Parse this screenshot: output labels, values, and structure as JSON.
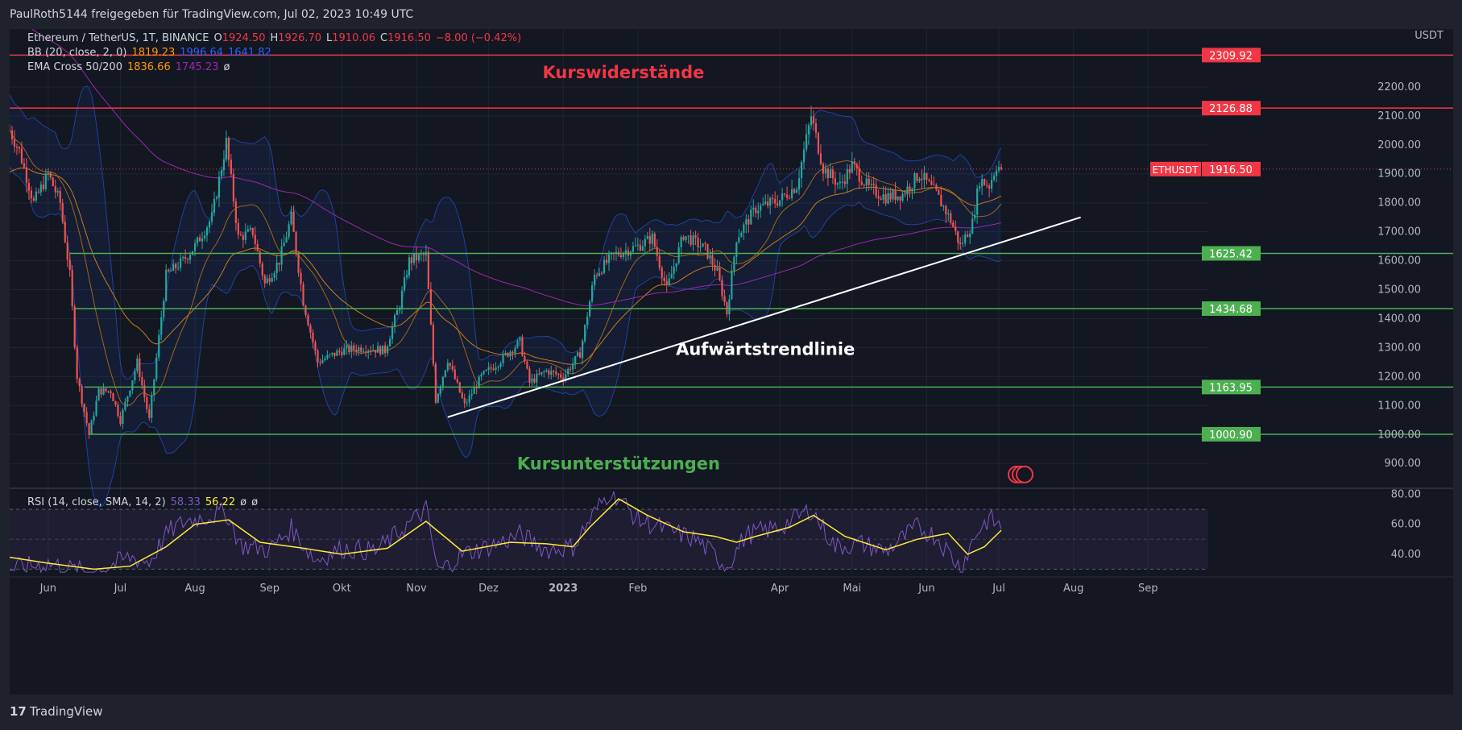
{
  "header": {
    "shared_by": "PaulRoth5144 freigegeben für TradingView.com, Jul 02, 2023 10:49 UTC"
  },
  "legend": {
    "symbol": "Ethereum / TetherUS, 1T, BINANCE",
    "o_label": "O",
    "o": "1924.50",
    "h_label": "H",
    "h": "1926.70",
    "l_label": "L",
    "l": "1910.06",
    "c_label": "C",
    "c": "1916.50",
    "change": "−8.00 (−0.42%)",
    "bb_label": "BB (20, close, 2, 0)",
    "bb_basis": "1819.23",
    "bb_upper": "1996.64",
    "bb_lower": "1641.82",
    "ema_label": "EMA Cross 50/200",
    "ema50": "1836.66",
    "ema200": "1745.23",
    "ema_extra": "ø",
    "rsi_label": "RSI (14, close, SMA, 14, 2)",
    "rsi": "58.33",
    "rsi_sma": "56.22",
    "rsi_extra1": "ø",
    "rsi_extra2": "ø"
  },
  "colors": {
    "up": "#26a69a",
    "down": "#ef5350",
    "resistance": "#f23645",
    "support": "#4caf50",
    "bb": "#2962ff",
    "ema50": "#ff9800",
    "ema200": "#9c27b0",
    "rsi": "#7e57c2",
    "rsi_sma": "#ffeb3b"
  },
  "chart_data": {
    "type": "candlestick",
    "symbol": "ETHUSDT",
    "currency": "USDT",
    "price_axis": {
      "range": [
        820,
        2400
      ],
      "ticks": [
        "900.00",
        "1000.00",
        "1100.00",
        "1200.00",
        "1300.00",
        "1400.00",
        "1500.00",
        "1600.00",
        "1700.00",
        "1800.00",
        "1900.00",
        "2000.00",
        "2100.00",
        "2200.00"
      ]
    },
    "x_axis": {
      "start": "2022-05-16",
      "end": "2023-09-26",
      "ticks": [
        {
          "date": "2022-06-01",
          "label": "Jun"
        },
        {
          "date": "2022-07-01",
          "label": "Jul"
        },
        {
          "date": "2022-08-01",
          "label": "Aug"
        },
        {
          "date": "2022-09-01",
          "label": "Sep"
        },
        {
          "date": "2022-10-01",
          "label": "Okt"
        },
        {
          "date": "2022-11-01",
          "label": "Nov"
        },
        {
          "date": "2022-12-01",
          "label": "Dez"
        },
        {
          "date": "2023-01-01",
          "label": "2023"
        },
        {
          "date": "2023-02-01",
          "label": "Feb"
        },
        {
          "date": "2023-04-01",
          "label": "Apr"
        },
        {
          "date": "2023-05-01",
          "label": "Mai"
        },
        {
          "date": "2023-06-01",
          "label": "Jun"
        },
        {
          "date": "2023-07-01",
          "label": "Jul"
        },
        {
          "date": "2023-08-01",
          "label": "Aug"
        },
        {
          "date": "2023-09-01",
          "label": "Sep"
        }
      ]
    },
    "resistances": [
      {
        "value": 2309.92,
        "label": "2309.92"
      },
      {
        "value": 2126.88,
        "label": "2126.88"
      }
    ],
    "supports": [
      {
        "value": 1625.42,
        "label": "1625.42",
        "from": "2022-06-10"
      },
      {
        "value": 1434.68,
        "label": "1434.68",
        "from": "2022-06-12"
      },
      {
        "value": 1163.95,
        "label": "1163.95",
        "from": "2022-06-16"
      },
      {
        "value": 1000.9,
        "label": "1000.90",
        "from": "2022-06-18"
      }
    ],
    "current_price": {
      "value": 1916.5,
      "label": "1916.50",
      "symbol_label": "ETHUSDT"
    },
    "trendline": {
      "from": {
        "date": "2022-11-14",
        "value": 1060
      },
      "to": {
        "date": "2023-08-04",
        "value": 1750
      }
    },
    "annotations": {
      "resistance": "Kurswiderstände",
      "support": "Kursunterstützungen",
      "trendline": "Aufwärtstrendlinie"
    },
    "price_path": [
      [
        "2022-05-16",
        2050
      ],
      [
        "2022-05-20",
        1980
      ],
      [
        "2022-05-26",
        1800
      ],
      [
        "2022-06-01",
        1900
      ],
      [
        "2022-06-06",
        1800
      ],
      [
        "2022-06-10",
        1550
      ],
      [
        "2022-06-13",
        1200
      ],
      [
        "2022-06-18",
        1000
      ],
      [
        "2022-06-22",
        1150
      ],
      [
        "2022-06-27",
        1150
      ],
      [
        "2022-07-01",
        1050
      ],
      [
        "2022-07-08",
        1250
      ],
      [
        "2022-07-13",
        1050
      ],
      [
        "2022-07-20",
        1550
      ],
      [
        "2022-07-27",
        1600
      ],
      [
        "2022-08-01",
        1650
      ],
      [
        "2022-08-08",
        1750
      ],
      [
        "2022-08-14",
        2010
      ],
      [
        "2022-08-19",
        1680
      ],
      [
        "2022-08-25",
        1700
      ],
      [
        "2022-08-30",
        1520
      ],
      [
        "2022-09-05",
        1600
      ],
      [
        "2022-09-10",
        1750
      ],
      [
        "2022-09-15",
        1460
      ],
      [
        "2022-09-21",
        1250
      ],
      [
        "2022-10-01",
        1290
      ],
      [
        "2022-10-10",
        1300
      ],
      [
        "2022-10-19",
        1290
      ],
      [
        "2022-10-25",
        1450
      ],
      [
        "2022-10-29",
        1600
      ],
      [
        "2022-11-05",
        1620
      ],
      [
        "2022-11-09",
        1120
      ],
      [
        "2022-11-14",
        1260
      ],
      [
        "2022-11-21",
        1100
      ],
      [
        "2022-11-28",
        1200
      ],
      [
        "2022-12-05",
        1250
      ],
      [
        "2022-12-14",
        1320
      ],
      [
        "2022-12-18",
        1180
      ],
      [
        "2022-12-25",
        1220
      ],
      [
        "2023-01-01",
        1200
      ],
      [
        "2023-01-08",
        1280
      ],
      [
        "2023-01-14",
        1550
      ],
      [
        "2023-01-22",
        1620
      ],
      [
        "2023-02-01",
        1650
      ],
      [
        "2023-02-07",
        1680
      ],
      [
        "2023-02-13",
        1500
      ],
      [
        "2023-02-20",
        1690
      ],
      [
        "2023-03-01",
        1640
      ],
      [
        "2023-03-06",
        1560
      ],
      [
        "2023-03-10",
        1420
      ],
      [
        "2023-03-14",
        1680
      ],
      [
        "2023-03-22",
        1780
      ],
      [
        "2023-04-01",
        1810
      ],
      [
        "2023-04-08",
        1860
      ],
      [
        "2023-04-14",
        2100
      ],
      [
        "2023-04-19",
        1920
      ],
      [
        "2023-04-26",
        1860
      ],
      [
        "2023-05-01",
        1930
      ],
      [
        "2023-05-08",
        1850
      ],
      [
        "2023-05-15",
        1820
      ],
      [
        "2023-05-22",
        1830
      ],
      [
        "2023-05-29",
        1900
      ],
      [
        "2023-06-05",
        1830
      ],
      [
        "2023-06-11",
        1740
      ],
      [
        "2023-06-15",
        1650
      ],
      [
        "2023-06-20",
        1730
      ],
      [
        "2023-06-23",
        1880
      ],
      [
        "2023-06-27",
        1860
      ],
      [
        "2023-06-30",
        1930
      ],
      [
        "2023-07-02",
        1916.5
      ]
    ],
    "rsi_axis": {
      "range": [
        27,
        83
      ],
      "ticks": [
        "40.00",
        "60.00",
        "80.00"
      ],
      "upper_band": 70,
      "lower_band": 30,
      "mid": 50
    },
    "rsi_path": [
      [
        "2022-05-16",
        30
      ],
      [
        "2022-06-01",
        34
      ],
      [
        "2022-06-13",
        29
      ],
      [
        "2022-06-20",
        28
      ],
      [
        "2022-07-05",
        38
      ],
      [
        "2022-07-13",
        35
      ],
      [
        "2022-07-21",
        55
      ],
      [
        "2022-07-28",
        62
      ],
      [
        "2022-08-14",
        68
      ],
      [
        "2022-08-20",
        46
      ],
      [
        "2022-09-01",
        43
      ],
      [
        "2022-09-10",
        57
      ],
      [
        "2022-09-20",
        36
      ],
      [
        "2022-10-01",
        44
      ],
      [
        "2022-10-15",
        42
      ],
      [
        "2022-10-25",
        55
      ],
      [
        "2022-11-05",
        70
      ],
      [
        "2022-11-10",
        28
      ],
      [
        "2022-11-20",
        40
      ],
      [
        "2022-12-05",
        47
      ],
      [
        "2022-12-14",
        53
      ],
      [
        "2022-12-25",
        43
      ],
      [
        "2023-01-05",
        45
      ],
      [
        "2023-01-15",
        70
      ],
      [
        "2023-01-21",
        83
      ],
      [
        "2023-02-01",
        63
      ],
      [
        "2023-02-10",
        58
      ],
      [
        "2023-02-25",
        50
      ],
      [
        "2023-03-10",
        32
      ],
      [
        "2023-03-18",
        53
      ],
      [
        "2023-04-01",
        58
      ],
      [
        "2023-04-14",
        70
      ],
      [
        "2023-04-24",
        45
      ],
      [
        "2023-05-05",
        47
      ],
      [
        "2023-05-15",
        42
      ],
      [
        "2023-05-28",
        58
      ],
      [
        "2023-06-05",
        52
      ],
      [
        "2023-06-15",
        31
      ],
      [
        "2023-06-22",
        55
      ],
      [
        "2023-06-27",
        64
      ],
      [
        "2023-07-02",
        58
      ]
    ],
    "rsi_sma_path": [
      [
        "2022-05-16",
        38
      ],
      [
        "2022-06-01",
        34
      ],
      [
        "2022-06-20",
        30
      ],
      [
        "2022-07-05",
        32
      ],
      [
        "2022-07-20",
        45
      ],
      [
        "2022-08-01",
        60
      ],
      [
        "2022-08-15",
        63
      ],
      [
        "2022-08-28",
        48
      ],
      [
        "2022-09-15",
        44
      ],
      [
        "2022-10-01",
        40
      ],
      [
        "2022-10-20",
        44
      ],
      [
        "2022-11-05",
        62
      ],
      [
        "2022-11-20",
        42
      ],
      [
        "2022-12-10",
        48
      ],
      [
        "2022-12-25",
        47
      ],
      [
        "2023-01-05",
        45
      ],
      [
        "2023-01-12",
        58
      ],
      [
        "2023-01-24",
        77
      ],
      [
        "2023-02-05",
        66
      ],
      [
        "2023-02-20",
        55
      ],
      [
        "2023-03-05",
        52
      ],
      [
        "2023-03-14",
        48
      ],
      [
        "2023-03-22",
        52
      ],
      [
        "2023-04-05",
        58
      ],
      [
        "2023-04-15",
        66
      ],
      [
        "2023-04-28",
        52
      ],
      [
        "2023-05-15",
        43
      ],
      [
        "2023-05-28",
        50
      ],
      [
        "2023-06-10",
        54
      ],
      [
        "2023-06-18",
        40
      ],
      [
        "2023-06-25",
        45
      ],
      [
        "2023-07-02",
        56
      ]
    ]
  },
  "footer": {
    "logo_mark": "17",
    "logo_text": "TradingView"
  }
}
